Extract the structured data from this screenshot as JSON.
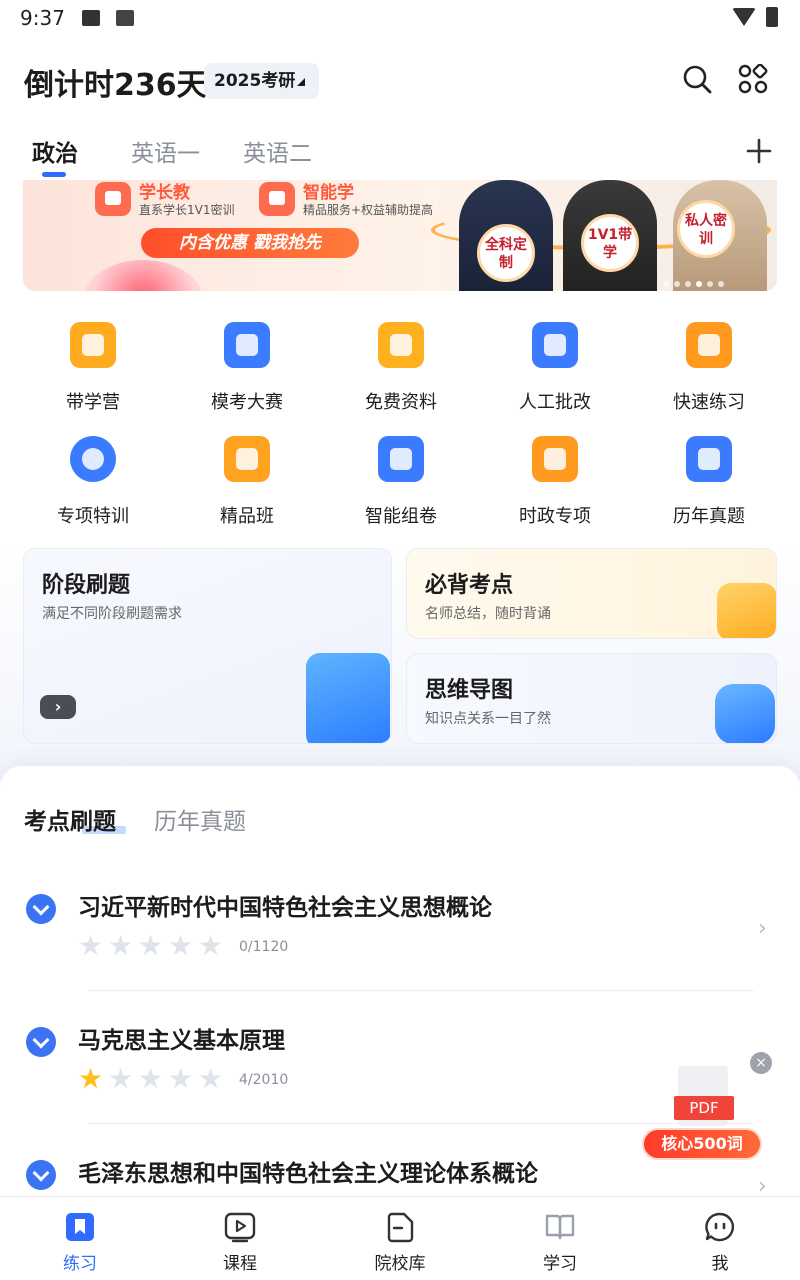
{
  "status_bar": {
    "time": "9:37"
  },
  "header": {
    "countdown": "倒计时236天",
    "year_badge": "2025考研",
    "icons": [
      "search-icon",
      "grid-apps-icon"
    ]
  },
  "subject_tabs": [
    {
      "label": "政治",
      "active": true
    },
    {
      "label": "英语一",
      "active": false
    },
    {
      "label": "英语二",
      "active": false
    }
  ],
  "banner": {
    "item1_title": "学长教",
    "item1_sub": "直系学长1V1密训",
    "item2_title": "智能学",
    "item2_sub": "精品服务+权益辅助提高",
    "cta": "内含优惠  戳我抢先",
    "badge1": "全科定制",
    "badge2": "1V1带学",
    "badge3": "私人密训",
    "dots": 6,
    "active_dot": 4
  },
  "grid": [
    {
      "label": "带学营",
      "icon": "shield-check-icon",
      "color": "#ffab1f"
    },
    {
      "label": "模考大赛",
      "icon": "trophy-icon",
      "color": "#3b7bff"
    },
    {
      "label": "免费资料",
      "icon": "search-doc-icon",
      "color": "#ffb01f"
    },
    {
      "label": "人工批改",
      "icon": "checklist-icon",
      "color": "#3b7bff"
    },
    {
      "label": "快速练习",
      "icon": "book-pen-icon",
      "color": "#ff9a1f"
    },
    {
      "label": "专项特训",
      "icon": "target-icon",
      "color": "#3b7bff"
    },
    {
      "label": "精品班",
      "icon": "diamond-board-icon",
      "color": "#ffa21f"
    },
    {
      "label": "智能组卷",
      "icon": "ai-paper-icon",
      "color": "#3b7bff"
    },
    {
      "label": "时政专项",
      "icon": "star-doc-icon",
      "color": "#ff9a1f"
    },
    {
      "label": "历年真题",
      "icon": "bookmark-clock-icon",
      "color": "#3b7bff"
    }
  ],
  "cards": {
    "stage": {
      "title": "阶段刷题",
      "sub": "满足不同阶段刷题需求",
      "arrow": "›"
    },
    "points": {
      "title": "必背考点",
      "sub": "名师总结，随时背诵"
    },
    "mindmap": {
      "title": "思维导图",
      "sub": "知识点关系一目了然"
    }
  },
  "section_tabs": [
    {
      "label": "考点刷题",
      "active": true
    },
    {
      "label": "历年真题",
      "active": false
    }
  ],
  "subjects": [
    {
      "title": "习近平新时代中国特色社会主义思想概论",
      "stars": 0,
      "progress": "0/1120"
    },
    {
      "title": "马克思主义基本原理",
      "stars": 1,
      "progress": "4/2010"
    },
    {
      "title": "毛泽东思想和中国特色社会主义理论体系概论",
      "stars": 0,
      "progress": ""
    }
  ],
  "pdf_float": {
    "tag": "PDF",
    "pill": "核心500词",
    "close": "×"
  },
  "bottom_nav": [
    {
      "label": "练习",
      "icon": "bookmark-icon",
      "active": true
    },
    {
      "label": "课程",
      "icon": "play-icon",
      "active": false
    },
    {
      "label": "院校库",
      "icon": "school-doc-icon",
      "active": false
    },
    {
      "label": "学习",
      "icon": "open-book-icon",
      "active": false
    },
    {
      "label": "我",
      "icon": "face-icon",
      "active": false
    }
  ]
}
